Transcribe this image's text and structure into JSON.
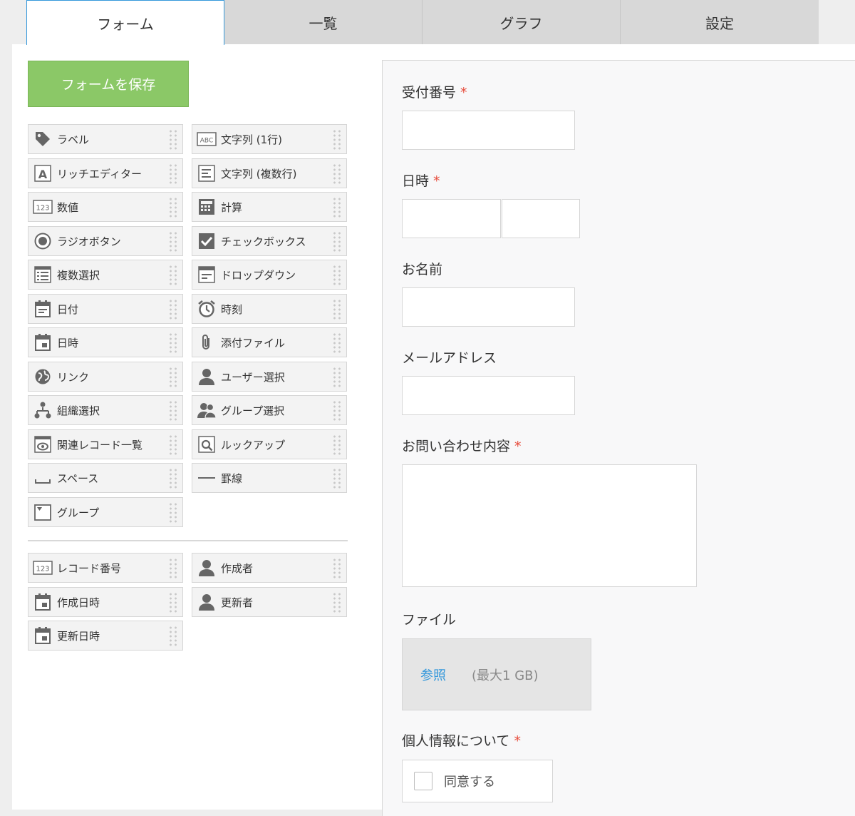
{
  "tabs": [
    "フォーム",
    "一覧",
    "グラフ",
    "設定"
  ],
  "save_button": "フォームを保存",
  "fields": [
    {
      "label": "ラベル",
      "icon": "tag-icon"
    },
    {
      "label": "文字列 (1行)",
      "icon": "abc-text-icon"
    },
    {
      "label": "リッチエディター",
      "icon": "rich-editor-icon"
    },
    {
      "label": "文字列 (複数行)",
      "icon": "multiline-text-icon"
    },
    {
      "label": "数値",
      "icon": "number-icon"
    },
    {
      "label": "計算",
      "icon": "calculator-icon"
    },
    {
      "label": "ラジオボタン",
      "icon": "radio-icon"
    },
    {
      "label": "チェックボックス",
      "icon": "checkbox-icon"
    },
    {
      "label": "複数選択",
      "icon": "multi-select-icon"
    },
    {
      "label": "ドロップダウン",
      "icon": "dropdown-icon"
    },
    {
      "label": "日付",
      "icon": "date-icon"
    },
    {
      "label": "時刻",
      "icon": "alarm-clock-icon"
    },
    {
      "label": "日時",
      "icon": "datetime-icon"
    },
    {
      "label": "添付ファイル",
      "icon": "paperclip-icon"
    },
    {
      "label": "リンク",
      "icon": "globe-icon"
    },
    {
      "label": "ユーザー選択",
      "icon": "user-icon"
    },
    {
      "label": "組織選択",
      "icon": "org-icon"
    },
    {
      "label": "グループ選択",
      "icon": "group-icon"
    },
    {
      "label": "関連レコード一覧",
      "icon": "related-records-icon"
    },
    {
      "label": "ルックアップ",
      "icon": "lookup-icon"
    },
    {
      "label": "スペース",
      "icon": "space-icon"
    },
    {
      "label": "罫線",
      "icon": "line-icon"
    },
    {
      "label": "グループ",
      "icon": "group-box-icon"
    }
  ],
  "system_fields": [
    {
      "label": "レコード番号",
      "icon": "number-icon"
    },
    {
      "label": "作成者",
      "icon": "user-icon"
    },
    {
      "label": "作成日時",
      "icon": "datetime-icon"
    },
    {
      "label": "更新者",
      "icon": "user-icon"
    },
    {
      "label": "更新日時",
      "icon": "datetime-icon"
    }
  ],
  "form": {
    "reception_number": "受付番号",
    "datetime": "日時",
    "name": "お名前",
    "email": "メールアドレス",
    "inquiry": "お問い合わせ内容",
    "file": "ファイル",
    "browse": "参照",
    "max_size": "(最大1 GB)",
    "privacy": "個人情報について",
    "agree": "同意する",
    "required_mark": "*"
  },
  "colors": {
    "accent": "#3498db",
    "save": "#8bc867",
    "required": "#e74c3c"
  }
}
